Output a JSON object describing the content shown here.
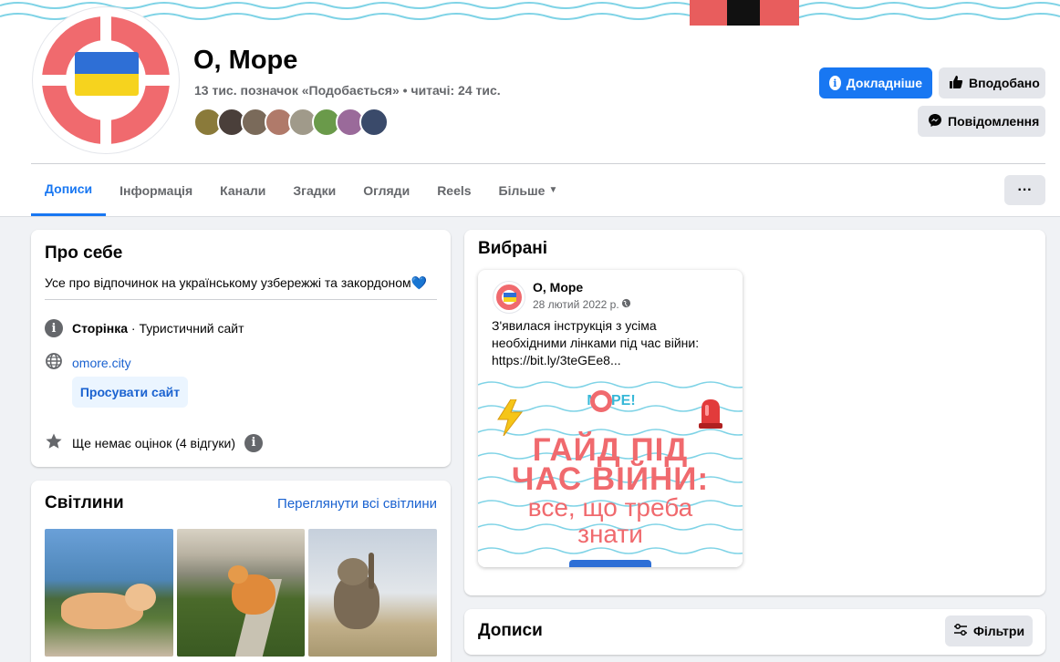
{
  "page": {
    "name": "О, Море",
    "stats": "13 тис. позначок «Подобається» • читачі: 24 тис."
  },
  "colors": {
    "accent": "#1877f2",
    "brand_red": "#f06a6e",
    "flag_blue": "#2e6fd6",
    "flag_yellow": "#f6d31e"
  },
  "actions": {
    "learn_more": "Докладніше",
    "liked": "Вподобано",
    "message": "Повідомлення"
  },
  "tabs": [
    {
      "label": "Дописи",
      "active": true
    },
    {
      "label": "Інформація"
    },
    {
      "label": "Канали"
    },
    {
      "label": "Згадки"
    },
    {
      "label": "Огляди"
    },
    {
      "label": "Reels"
    },
    {
      "label": "Більше"
    }
  ],
  "more_menu": "···",
  "about": {
    "title": "Про себе",
    "bio": "Усе про відпочинок на українському узбережжі та закордоном",
    "bio_emoji": "💙",
    "category_label": "Сторінка",
    "category_value": " · Туристичний сайт",
    "website": "omore.city",
    "promote": "Просувати сайт",
    "rating": "Ще немає оцінок (4 відгуки)"
  },
  "photos": {
    "title": "Світлини",
    "see_all": "Переглянути всі світлини"
  },
  "featured": {
    "title": "Вибрані",
    "post": {
      "author": "О, Море",
      "date": "28 лютий 2022 р.",
      "text": "З'явилася інструкція з усіма необхідними лінками під час війни: https://bit.ly/3teGEe8...",
      "image": {
        "logo": "М   РЕ!",
        "line1": "ГАЙД ПІД",
        "line2": "ЧАС ВІЙНИ:",
        "line3": "все, що треба",
        "line4": "знати"
      }
    }
  },
  "posts": {
    "title": "Дописи",
    "filters": "Фільтри"
  }
}
